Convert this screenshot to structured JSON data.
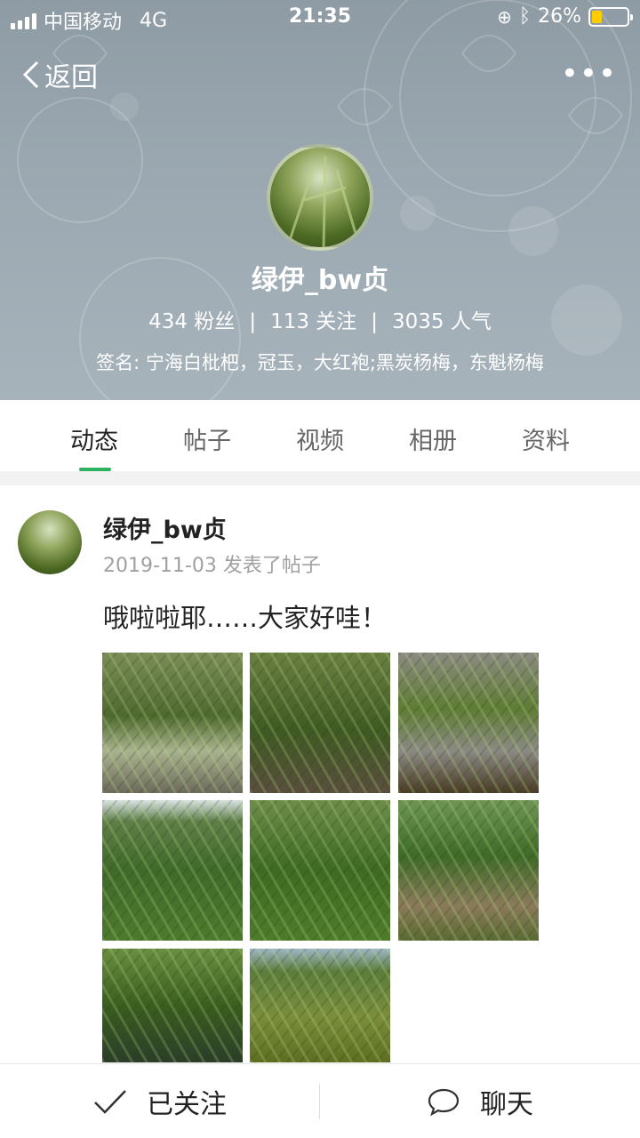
{
  "status_bar": {
    "carrier": "中国移动",
    "network": "4G",
    "time": "21:35",
    "battery": "26%",
    "battery_level": 0.26
  },
  "nav": {
    "back_label": "返回",
    "more_icon": "more-icon"
  },
  "profile": {
    "name": "绿伊_bw贞",
    "fans": "434 粉丝",
    "following": "113 关注",
    "popularity": "3035 人气",
    "signature": "签名: 宁海白枇杷，冠玉，大红袍;黑炭杨梅，东魁杨梅"
  },
  "tabs": [
    {
      "label": "动态",
      "active": true
    },
    {
      "label": "帖子",
      "active": false
    },
    {
      "label": "视频",
      "active": false
    },
    {
      "label": "相册",
      "active": false
    },
    {
      "label": "资料",
      "active": false
    }
  ],
  "post": {
    "author": "绿伊_bw贞",
    "meta": "2019-11-03 发表了帖子",
    "text": "哦啦啦耶……大家好哇！",
    "image_count": 8
  },
  "bottom": {
    "follow_label": "已关注",
    "chat_label": "聊天"
  },
  "colors": {
    "accent": "#2bb35e",
    "battery": "#ffcc00",
    "banner": "#9aa7b0"
  }
}
